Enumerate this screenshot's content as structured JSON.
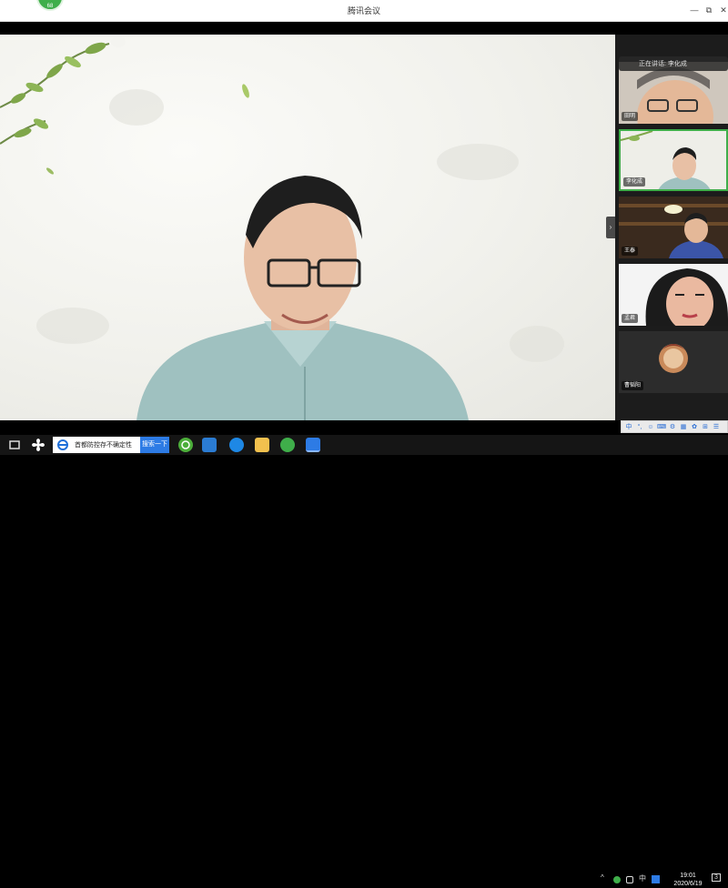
{
  "window": {
    "title": "腾讯会议",
    "badge": "68"
  },
  "window_controls": {
    "minimize": "—",
    "maximize": "⧉",
    "close": "✕"
  },
  "speaking": {
    "label": "正在讲话: 李化成"
  },
  "participants": [
    {
      "name": "田明"
    },
    {
      "name": "李化成"
    },
    {
      "name": "王泰"
    },
    {
      "name": "孟君"
    },
    {
      "name": "曹韬阳"
    }
  ],
  "panel_toggle": {
    "glyph": "›"
  },
  "ime": {
    "items": [
      "中",
      "°,",
      "☺",
      "⌨",
      "⚙",
      "▦",
      "✿",
      "⊞",
      "☰"
    ]
  },
  "taskbar": {
    "search_text": "首都防控存不确定性",
    "search_button": "搜索一下",
    "tray_caret": "^",
    "ime_lang": "中",
    "time": "19:01",
    "date": "2020/6/19",
    "notifications": "3"
  },
  "colors": {
    "accent": "#2d7be5",
    "badge": "#3fae4a",
    "panel": "#1c1c1c"
  }
}
